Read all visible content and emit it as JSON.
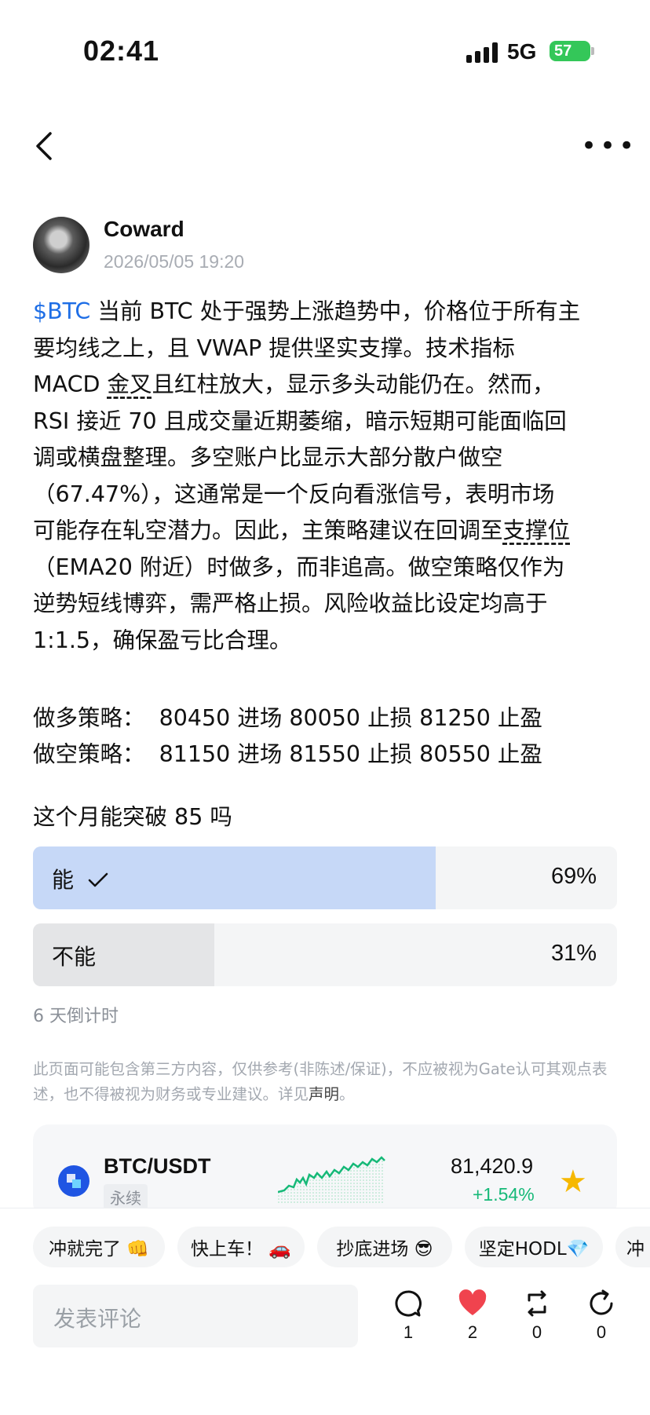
{
  "status_bar": {
    "time": "02:41",
    "network": "5G",
    "battery": "57"
  },
  "post": {
    "author": "Coward",
    "datetime": "2026/05/05 19:20",
    "tag": "$BTC",
    "lines": [
      " 当前 BTC 处于强势上涨趋势中，价格位于所有主",
      "要均线之上，且 VWAP 提供坚实支撑。技术指标",
      "MACD ",
      "金叉",
      "且红柱放大，显示多头动能仍在。然而，",
      "RSI 接近 70 且成交量近期萎缩，暗示短期可能面临回",
      "调或横盘整理。多空账户比显示大部分散户做空",
      "（67.47%），这通常是一个反向看涨信号，表明市场",
      "可能存在轧空潜力。因此，主策略建议在回调至",
      "支撑位",
      "（EMA20 附近）时做多，而非追高。做空策略仅作为",
      "逆势短线博弈，需严格止损。风险收益比设定均高于",
      "1:1.5，确保盈亏比合理。"
    ],
    "strategy_long": "做多策略：  80450 进场 80050 止损 81250 止盈",
    "strategy_short": "做空策略：  81150 进场 81550 止损 80550 止盈"
  },
  "poll": {
    "question": "这个月能突破 85 吗",
    "options": [
      {
        "label": "能",
        "percent": "69%",
        "value": 0.69,
        "selected": true,
        "color": "#c6d8f7"
      },
      {
        "label": "不能",
        "percent": "31%",
        "value": 0.31,
        "selected": false,
        "color": "#e4e5e7"
      }
    ],
    "countdown": "6 天倒计时"
  },
  "disclaimer": {
    "text": "此页面可能包含第三方内容，仅供参考(非陈述/保证)，不应被视为Gate认可其观点表述，也不得被视为财务或专业建议。详见",
    "link": "声明",
    "end": "。"
  },
  "market": {
    "pair": "BTC/USDT",
    "type": "永续",
    "price": "81,420.9",
    "change": "+1.54%",
    "change_color": "#16b978"
  },
  "reactions": [
    "冲就完了 👊",
    "快上车！ 🚗",
    "抄底进场 😎",
    "坚定HODL💎",
    "冲"
  ],
  "comment_placeholder": "发表评论",
  "actions": {
    "comments": "1",
    "likes": "2",
    "reposts": "0",
    "shares": "0"
  },
  "colors": {
    "accent_blue": "#1e6ee6",
    "like_red": "#f0434e",
    "star": "#f6b800"
  }
}
